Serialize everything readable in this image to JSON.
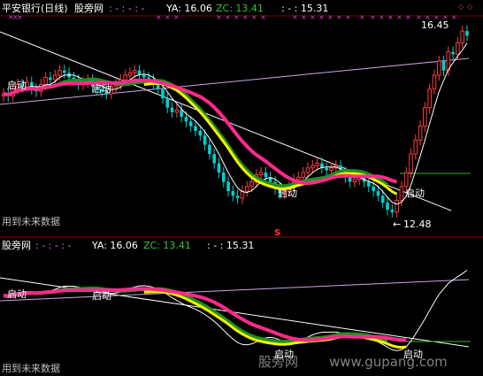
{
  "colors": {
    "background": "#000000",
    "up": "#ff3b3b",
    "down": "#00d0d0",
    "pink": "#ff2a8a",
    "green": "#1f8f1f",
    "yellow": "#f5f500",
    "white": "#ffffff",
    "lavender": "#c9a6e6",
    "label": "#ffff66",
    "zc": "#34c734",
    "marker": "#cc44cc"
  },
  "top_panel": {
    "title": "平安银行(日线)",
    "indicator": "股旁网",
    "dashes_a": ": - : - : -",
    "ya_label": "YA: 16.06",
    "zc_label": "ZC: 13.41",
    "dash_c": ": - : 15.31",
    "high_label": "16.45",
    "low_label": "12.48",
    "note": "用到未来数据",
    "signal_label": "启动",
    "marker_glyph": "×",
    "diamond_glyph": "◇",
    "s_glyph": "S"
  },
  "bottom_panel": {
    "indicator": "股旁网",
    "dashes_a": ": - : - : -",
    "ya_label": "YA: 16.06",
    "zc_label": "ZC: 13.41",
    "dash_c": ": - : 15.31",
    "note": "用到未来数据",
    "signal_label": "启动"
  },
  "watermark": {
    "text1": "股旁网",
    "text2": "www.gupang.com"
  },
  "chart_data": {
    "type": "candlestick",
    "price_axis": {
      "ylim": [
        12.2,
        16.7
      ]
    },
    "high": 16.45,
    "low": 12.48,
    "indicators": {
      "YA": 16.06,
      "ZC": 13.41,
      "C": 15.31
    },
    "closes": [
      15.1,
      15.05,
      15.2,
      15.3,
      15.25,
      15.35,
      15.2,
      15.15,
      15.3,
      15.45,
      15.4,
      15.5,
      15.6,
      15.55,
      15.45,
      15.4,
      15.3,
      15.35,
      15.4,
      15.25,
      15.2,
      15.15,
      15.1,
      15.25,
      15.3,
      15.4,
      15.5,
      15.55,
      15.6,
      15.5,
      15.45,
      15.4,
      15.3,
      15.2,
      15.0,
      14.8,
      14.7,
      14.75,
      14.6,
      14.5,
      14.4,
      14.3,
      14.2,
      14.0,
      13.8,
      13.6,
      13.4,
      13.2,
      13.0,
      12.9,
      12.85,
      13.0,
      13.1,
      13.2,
      13.35,
      13.4,
      13.3,
      13.2,
      13.05,
      12.95,
      13.0,
      13.1,
      13.25,
      13.3,
      13.4,
      13.5,
      13.55,
      13.6,
      13.5,
      13.45,
      13.5,
      13.55,
      13.4,
      13.3,
      13.2,
      13.25,
      13.3,
      13.2,
      13.1,
      13.0,
      12.9,
      12.75,
      12.6,
      12.55,
      12.8,
      13.1,
      13.4,
      13.8,
      14.1,
      14.4,
      14.8,
      15.2,
      15.5,
      15.8,
      15.6,
      16.0,
      15.95,
      16.2,
      16.45,
      16.35
    ]
  }
}
